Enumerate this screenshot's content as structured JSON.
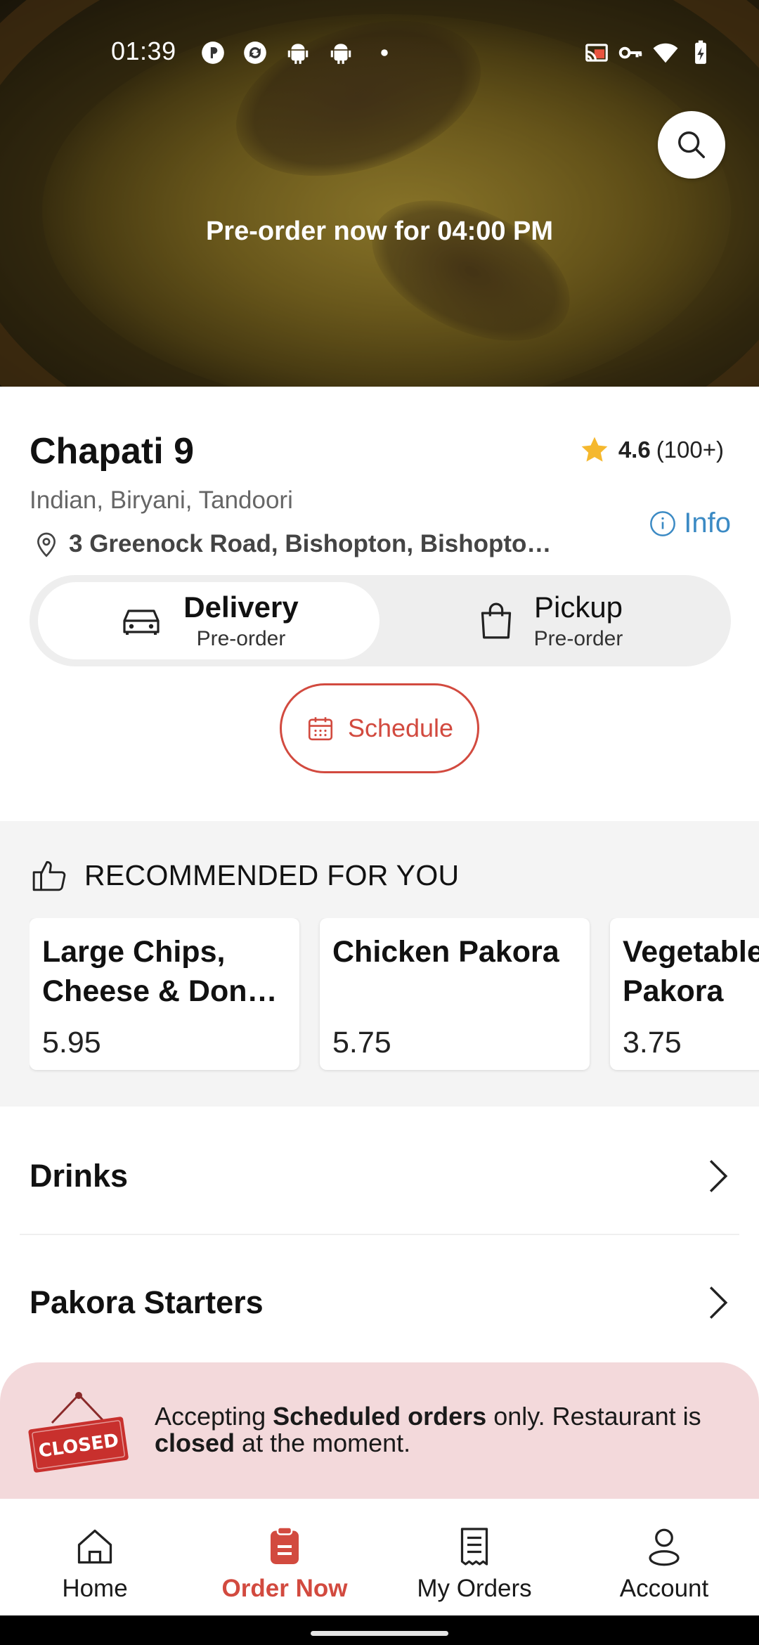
{
  "status_bar": {
    "time": "01:39",
    "left_icons": [
      "app-icon",
      "sync-icon",
      "android-icon",
      "android-icon",
      "dot-icon"
    ],
    "right_icons": [
      "cast-icon",
      "vpn-key-icon",
      "wifi-icon",
      "battery-charging-icon"
    ]
  },
  "hero": {
    "banner": "Pre-order now for 04:00 PM",
    "search_icon": "search-icon"
  },
  "restaurant": {
    "name": "Chapati 9",
    "rating": "4.6",
    "rating_count": "(100+)",
    "cuisines": "Indian, Biryani, Tandoori",
    "address": "3 Greenock Road, Bishopton, Bishopto…",
    "info_label": "Info"
  },
  "modes": {
    "delivery": {
      "label": "Delivery",
      "sub": "Pre-order"
    },
    "pickup": {
      "label": "Pickup",
      "sub": "Pre-order"
    },
    "selected": "delivery"
  },
  "schedule": {
    "label": "Schedule"
  },
  "recommended": {
    "title": "RECOMMENDED FOR YOU",
    "items": [
      {
        "name_line1": "Large Chips,",
        "name_line2": "Cheese & Donn…",
        "price": "5.95"
      },
      {
        "name_line1": "Chicken Pakora",
        "name_line2": "",
        "price": "5.75"
      },
      {
        "name_line1": "Vegetable",
        "name_line2": "Pakora",
        "price": "3.75"
      }
    ]
  },
  "categories": [
    {
      "label": "Drinks"
    },
    {
      "label": "Pakora Starters"
    }
  ],
  "closed_banner": {
    "sign_text": "CLOSED",
    "text_part1": "Accepting ",
    "text_bold1": "Scheduled orders",
    "text_part2": " only. Restaurant is ",
    "text_bold2": "closed",
    "text_part3": " at the moment."
  },
  "bottom_nav": {
    "items": [
      {
        "label": "Home",
        "icon": "home-icon"
      },
      {
        "label": "Order Now",
        "icon": "order-icon"
      },
      {
        "label": "My Orders",
        "icon": "receipt-icon"
      },
      {
        "label": "Account",
        "icon": "person-icon"
      }
    ],
    "active": "Order Now"
  },
  "colors": {
    "accent": "#d24a3f",
    "link": "#3b8ac4",
    "star": "#f5b82e",
    "closed_bg": "#f3d9db",
    "section_bg": "#f4f4f4"
  }
}
